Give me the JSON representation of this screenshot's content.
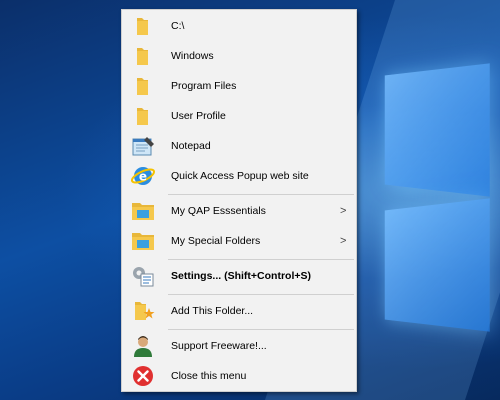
{
  "menu": {
    "items": [
      {
        "label": "C:\\",
        "icon": "folder-icon"
      },
      {
        "label": "Windows",
        "icon": "folder-icon"
      },
      {
        "label": "Program Files",
        "icon": "folder-icon"
      },
      {
        "label": "User Profile",
        "icon": "folder-icon"
      },
      {
        "label": "Notepad",
        "icon": "notepad-icon"
      },
      {
        "label": "Quick Access Popup web site",
        "icon": "internet-explorer-icon"
      },
      {
        "label": "My QAP Esssentials",
        "icon": "folder-blue-icon",
        "submenu": ">"
      },
      {
        "label": "My Special Folders",
        "icon": "folder-blue-icon",
        "submenu": ">"
      },
      {
        "label": "Settings... (Shift+Control+S)",
        "icon": "settings-icon"
      },
      {
        "label": "Add This Folder...",
        "icon": "add-folder-icon"
      },
      {
        "label": "Support Freeware!...",
        "icon": "support-user-icon"
      },
      {
        "label": "Close this menu",
        "icon": "close-icon"
      }
    ]
  },
  "colors": {
    "menu_background": "#f2f2f2",
    "folder_yellow": "#f5c84c",
    "close_red": "#e03030",
    "desktop_blue": "#0d4fa3"
  }
}
